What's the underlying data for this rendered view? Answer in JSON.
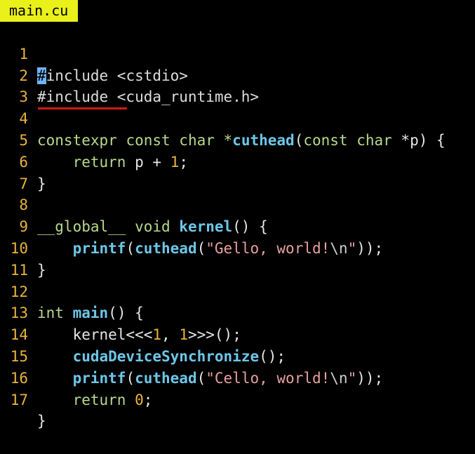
{
  "tab": {
    "filename": "main.cu"
  },
  "lines": [
    {
      "n": "1"
    },
    {
      "n": "2"
    },
    {
      "n": "3"
    },
    {
      "n": "4"
    },
    {
      "n": "5"
    },
    {
      "n": "6"
    },
    {
      "n": "7"
    },
    {
      "n": "8"
    },
    {
      "n": "9"
    },
    {
      "n": "10"
    },
    {
      "n": "11"
    },
    {
      "n": "12"
    },
    {
      "n": "13"
    },
    {
      "n": "14"
    },
    {
      "n": "15"
    },
    {
      "n": "16"
    },
    {
      "n": "17"
    }
  ],
  "code": {
    "l1": {
      "cursor": "#",
      "rest": "include <cstdio>"
    },
    "l2": {
      "text": "#include <cuda_runtime.h>"
    },
    "l4": {
      "kw1": "constexpr",
      "kw2": " const char *",
      "fn": "cuthead",
      "p1": "(",
      "kw3": "const char",
      "p2": " *p) {"
    },
    "l5": {
      "indent": "    ",
      "kw": "return",
      "p1": " p + ",
      "num": "1",
      "p2": ";"
    },
    "l6": {
      "text": "}"
    },
    "l8": {
      "kw1": "__global__",
      "kw2": " void ",
      "fn": "kernel",
      "p1": "() {"
    },
    "l9": {
      "indent": "    ",
      "fn1": "printf",
      "p1": "(",
      "fn2": "cuthead",
      "p2": "(",
      "str1": "\"Gello, world!",
      "esc": "\\n",
      "str2": "\"",
      "p3": "));"
    },
    "l10": {
      "text": "}"
    },
    "l12": {
      "kw": "int",
      "p0": " ",
      "fn": "main",
      "p1": "() {"
    },
    "l13": {
      "indent": "    ",
      "p1": "kernel<<<",
      "num1": "1",
      "p2": ", ",
      "num2": "1",
      "p3": ">>>();"
    },
    "l14": {
      "indent": "    ",
      "fn": "cudaDeviceSynchronize",
      "p1": "();"
    },
    "l15": {
      "indent": "    ",
      "fn1": "printf",
      "p1": "(",
      "fn2": "cuthead",
      "p2": "(",
      "str1": "\"Cello, world!",
      "esc": "\\n",
      "str2": "\"",
      "p3": "));"
    },
    "l16": {
      "indent": "    ",
      "kw": "return",
      "p1": " ",
      "num": "0",
      "p2": ";"
    },
    "l17": {
      "text": "}"
    }
  },
  "colors": {
    "background": "#000000",
    "tab": "#eaf01a",
    "line_number": "#e8b33d",
    "keyword": "#b7d98c",
    "function": "#6ec6e8",
    "string": "#e9a0a0",
    "underline": "#d11a1a",
    "cursor": "#6fb3f2"
  }
}
